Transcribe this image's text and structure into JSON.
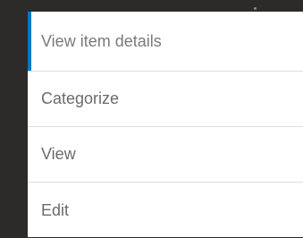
{
  "menu": {
    "items": [
      {
        "label": "View item details",
        "active": true
      },
      {
        "label": "Categorize",
        "active": false
      },
      {
        "label": "View",
        "active": false
      },
      {
        "label": "Edit",
        "active": false
      }
    ]
  },
  "colors": {
    "background": "#2d2b2a",
    "accent": "#0079c1",
    "text": "#6b6b6b"
  }
}
